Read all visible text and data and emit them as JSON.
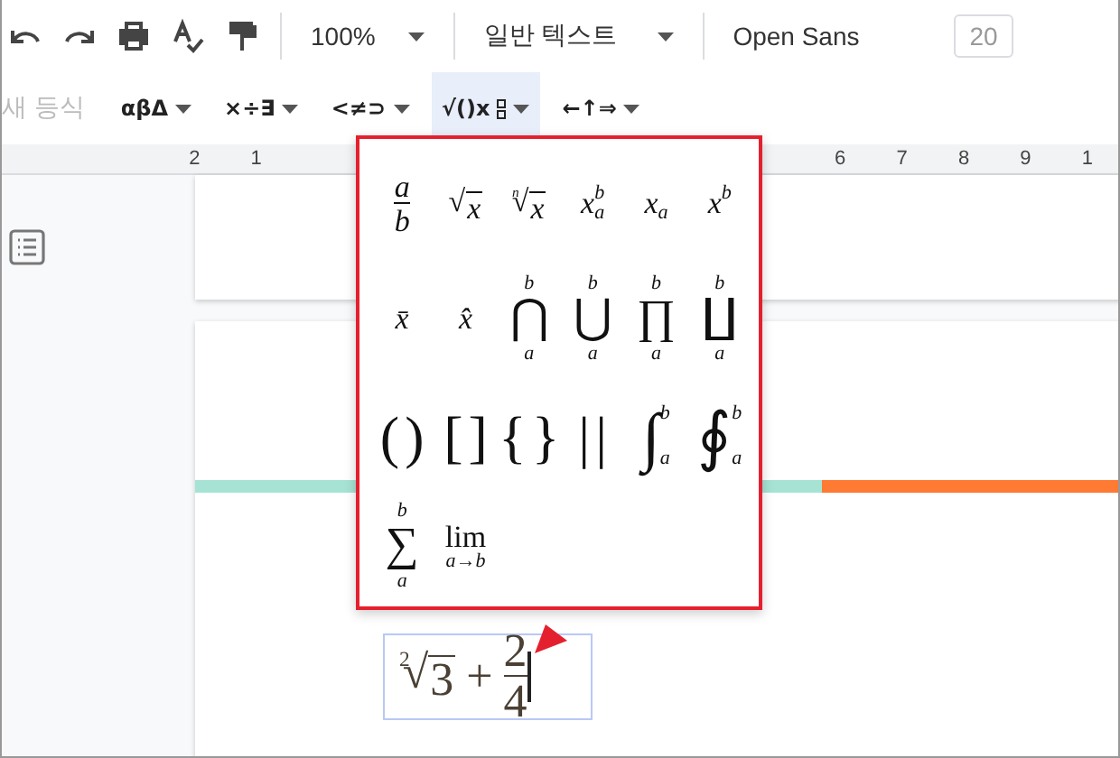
{
  "toolbar": {
    "zoom": "100%",
    "style": "일반 텍스트",
    "font": "Open Sans",
    "font_size": "20"
  },
  "equation_toolbar": {
    "new_equation": {
      "label": "새 등식",
      "disabled": true
    },
    "menus": [
      {
        "label": "αβΔ",
        "selected": false
      },
      {
        "label": "×÷∃",
        "selected": false
      },
      {
        "label": "<≠⊃",
        "selected": false
      },
      {
        "label": "√()x",
        "selected": true
      },
      {
        "label": "←↑⇒",
        "selected": false
      }
    ]
  },
  "ruler": {
    "left_numbers": [
      "2",
      "1"
    ],
    "right_numbers": [
      "6",
      "7",
      "8",
      "9",
      "1"
    ]
  },
  "math_menu": {
    "items": [
      {
        "kind": "fraction",
        "num": "a",
        "den": "b"
      },
      {
        "kind": "root",
        "sign": "√",
        "radicand": "x"
      },
      {
        "kind": "root",
        "sign": "√",
        "index": "n",
        "radicand": "x"
      },
      {
        "kind": "script",
        "base": "x",
        "sup": "b",
        "sub": "a"
      },
      {
        "kind": "script",
        "base": "x",
        "sub": "a"
      },
      {
        "kind": "script",
        "base": "x",
        "sup": "b"
      },
      {
        "kind": "plain",
        "text": "x̄"
      },
      {
        "kind": "plain",
        "text": "x̂"
      },
      {
        "kind": "bigop",
        "sign": "⋂",
        "upper": "b",
        "lower": "a"
      },
      {
        "kind": "bigop",
        "sign": "⋃",
        "upper": "b",
        "lower": "a"
      },
      {
        "kind": "bigop",
        "sign": "∏",
        "upper": "b",
        "lower": "a"
      },
      {
        "kind": "bigop",
        "sign": "∐",
        "upper": "b",
        "lower": "a"
      },
      {
        "kind": "bracket",
        "open": "(",
        "close": ")"
      },
      {
        "kind": "bracket",
        "open": "[",
        "close": "]"
      },
      {
        "kind": "bracket",
        "open": "{",
        "close": "}"
      },
      {
        "kind": "bracket",
        "open": "|",
        "close": "|"
      },
      {
        "kind": "integral",
        "sign": "∫",
        "upper": "b",
        "lower": "a"
      },
      {
        "kind": "integral",
        "sign": "∮",
        "upper": "b",
        "lower": "a"
      },
      {
        "kind": "bigop",
        "sign": "∑",
        "upper": "b",
        "lower": "a"
      },
      {
        "kind": "limit",
        "text": "lim",
        "lower": "a→b"
      }
    ]
  },
  "equation": {
    "parts": [
      {
        "kind": "root",
        "sign": "√",
        "index": "2",
        "radicand": "3"
      },
      {
        "kind": "op",
        "text": "+"
      },
      {
        "kind": "fraction",
        "num": "2",
        "den": "4"
      }
    ]
  }
}
